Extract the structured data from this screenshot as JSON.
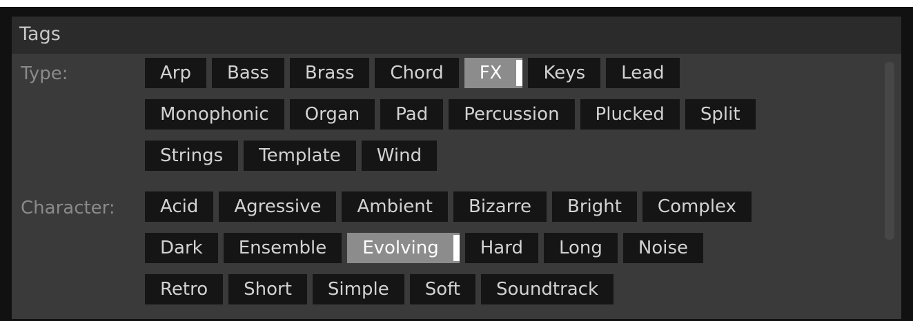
{
  "panel": {
    "title": "Tags"
  },
  "type_row": {
    "label": "Type:",
    "tags": [
      "Arp",
      "Bass",
      "Brass",
      "Chord",
      "FX",
      "Keys",
      "Lead",
      "Monophonic",
      "Organ",
      "Pad",
      "Percussion",
      "Plucked",
      "Split",
      "Strings",
      "Template",
      "Wind"
    ],
    "selected": "FX"
  },
  "character_row": {
    "label": "Character:",
    "tags": [
      "Acid",
      "Agressive",
      "Ambient",
      "Bizarre",
      "Bright",
      "Complex",
      "Dark",
      "Ensemble",
      "Evolving",
      "Hard",
      "Long",
      "Noise",
      "Retro",
      "Short",
      "Simple",
      "Soft",
      "Soundtrack"
    ],
    "selected": "Evolving"
  },
  "colors": {
    "background": "#3a3a3a",
    "titlebar": "#2b2b2b",
    "tag": "#151515",
    "tag_selected": "#8c8c8c"
  }
}
